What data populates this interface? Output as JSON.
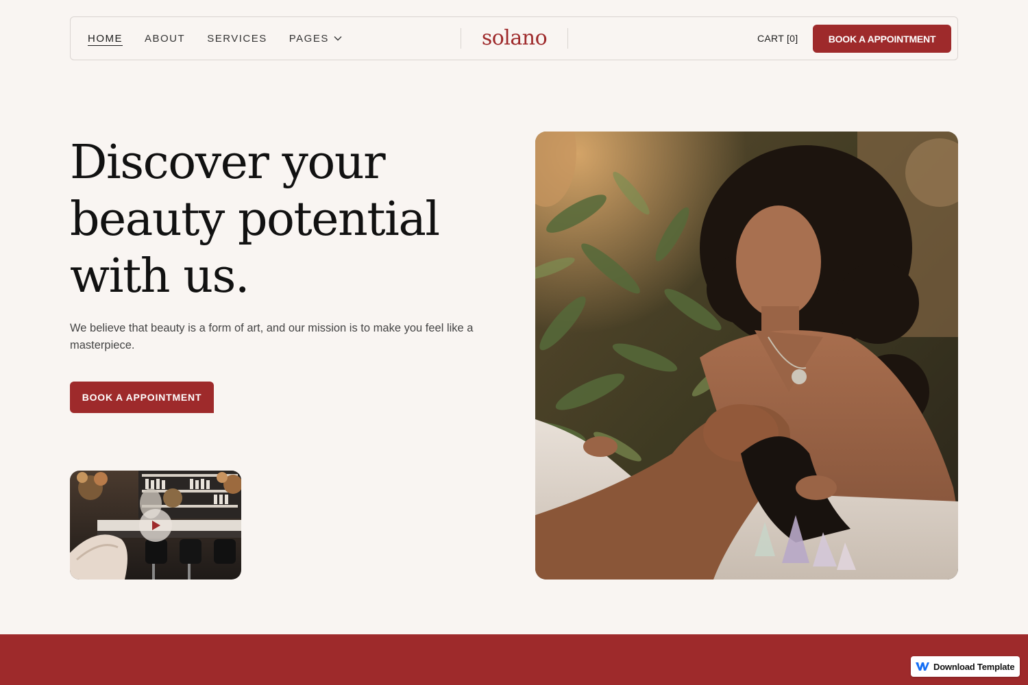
{
  "nav": {
    "links": [
      {
        "label": "HOME",
        "active": true
      },
      {
        "label": "ABOUT",
        "active": false
      },
      {
        "label": "SERVICES",
        "active": false
      },
      {
        "label": "PAGES",
        "active": false
      }
    ],
    "logo": "solano",
    "cart_label": "CART [0]",
    "book_button": "BOOK A APPOINTMENT"
  },
  "hero": {
    "headline_lines": [
      "Discover your",
      "beauty potential",
      "with us."
    ],
    "subtext": "We believe that beauty is a form of art, and our mission is to make you feel like a masterpiece.",
    "cta_button": "BOOK A APPOINTMENT",
    "video_play_icon": "play-icon",
    "image_subject": "massage-spa-photo"
  },
  "badge": {
    "label": "Download Template",
    "icon": "webflow-logo-icon"
  },
  "colors": {
    "accent": "#9e2a2b",
    "background": "#f9f5f2",
    "text": "#111111"
  }
}
